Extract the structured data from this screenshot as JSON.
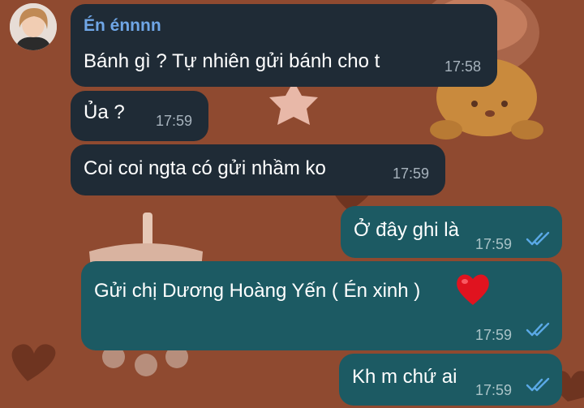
{
  "chat": {
    "messages": [
      {
        "id": "m1",
        "direction": "incoming",
        "sender": "Én énnnn",
        "text": "Bánh gì ? Tự nhiên gửi bánh cho t",
        "time": "17:58"
      },
      {
        "id": "m2",
        "direction": "incoming",
        "text": "Ủa ?",
        "time": "17:59"
      },
      {
        "id": "m3",
        "direction": "incoming",
        "text": "Coi coi ngta có gửi nhầm ko",
        "time": "17:59"
      },
      {
        "id": "m4",
        "direction": "outgoing",
        "text": "Ở đây ghi là",
        "time": "17:59",
        "status": "read"
      },
      {
        "id": "m5",
        "direction": "outgoing",
        "text": "Gửi chị Dương Hoàng Yến ( Én xinh )",
        "emoji": "red-heart",
        "time": "17:59",
        "status": "read"
      },
      {
        "id": "m6",
        "direction": "outgoing",
        "text": "Kh m chứ ai",
        "time": "17:59",
        "status": "read"
      }
    ]
  },
  "colors": {
    "wallpaper": "#8f4a30",
    "incoming_bubble": "#1f2b36",
    "outgoing_bubble": "#1c5a63",
    "sender_name": "#6fa6e6",
    "read_check": "#5aa9e6",
    "heart": "#e0131f"
  }
}
